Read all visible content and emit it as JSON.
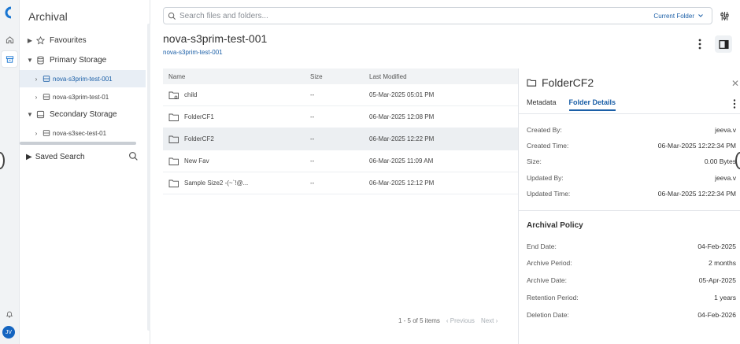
{
  "sidebar": {
    "title": "Archival",
    "items": [
      {
        "label": "Favourites"
      },
      {
        "label": "Primary Storage"
      },
      {
        "label": "nova-s3prim-test-001"
      },
      {
        "label": "nova-s3prim-test-01"
      },
      {
        "label": "Secondary Storage"
      },
      {
        "label": "nova-s3sec-test-01"
      }
    ],
    "saved_search": "Saved Search"
  },
  "rail": {
    "avatar_initials": "JV"
  },
  "search": {
    "placeholder": "Search files and folders...",
    "scope": "Current Folder"
  },
  "main": {
    "title": "nova-s3prim-test-001",
    "breadcrumb": "nova-s3prim-test-001",
    "columns": [
      "Name",
      "Size",
      "Last Modified"
    ],
    "rows": [
      {
        "name": "child",
        "size": "--",
        "modified": "05-Mar-2025 05:01 PM"
      },
      {
        "name": "FolderCF1",
        "size": "--",
        "modified": "06-Mar-2025 12:08 PM"
      },
      {
        "name": "FolderCF2",
        "size": "--",
        "modified": "06-Mar-2025 12:22 PM"
      },
      {
        "name": "New Fav",
        "size": "--",
        "modified": "06-Mar-2025 11:09 AM"
      },
      {
        "name": "Sample Size2 -(~`!@...",
        "size": "--",
        "modified": "06-Mar-2025 12:12 PM"
      }
    ],
    "pager": {
      "summary": "1 - 5 of 5 items",
      "prev": "‹ Previous",
      "next": "Next ›"
    }
  },
  "details": {
    "title": "FolderCF2",
    "tabs": [
      "Metadata",
      "Folder Details"
    ],
    "fields": [
      {
        "label": "Created By:",
        "value": "jeeva.v"
      },
      {
        "label": "Created Time:",
        "value": "06-Mar-2025 12:22:34 PM"
      },
      {
        "label": "Size:",
        "value": "0.00 Bytes"
      },
      {
        "label": "Updated By:",
        "value": "jeeva.v"
      },
      {
        "label": "Updated Time:",
        "value": "06-Mar-2025 12:22:34 PM"
      }
    ],
    "policy_title": "Archival Policy",
    "policy": [
      {
        "label": "End Date:",
        "value": "04-Feb-2025"
      },
      {
        "label": "Archive Period:",
        "value": "2 months"
      },
      {
        "label": "Archive Date:",
        "value": "05-Apr-2025"
      },
      {
        "label": "Retention Period:",
        "value": "1 years"
      },
      {
        "label": "Deletion Date:",
        "value": "04-Feb-2026"
      }
    ]
  },
  "colors": {
    "accent": "#1b5fa7",
    "selected_bg": "#e8eef5"
  }
}
